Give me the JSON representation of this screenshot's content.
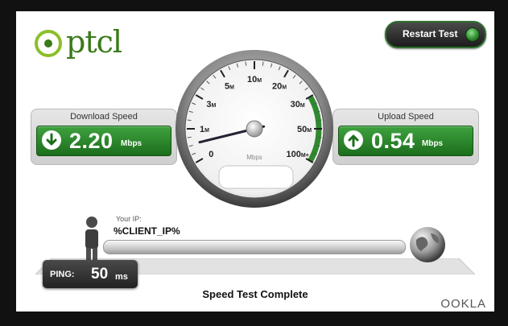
{
  "brand": {
    "logo_text": "ptcl",
    "footer_logo": "OOKLA",
    "accent": "#2f8a2f"
  },
  "header": {
    "restart_label": "Restart Test"
  },
  "download": {
    "title": "Download Speed",
    "value": "2.20",
    "unit": "Mbps",
    "icon": "down-arrow-icon"
  },
  "upload": {
    "title": "Upload Speed",
    "value": "0.54",
    "unit": "Mbps",
    "icon": "up-arrow-icon"
  },
  "gauge": {
    "unit_label": "Mbps",
    "ticks": [
      {
        "label": "0",
        "sub": ""
      },
      {
        "label": "1",
        "sub": "M"
      },
      {
        "label": "3",
        "sub": "M"
      },
      {
        "label": "5",
        "sub": "M"
      },
      {
        "label": "10",
        "sub": "M"
      },
      {
        "label": "20",
        "sub": "M"
      },
      {
        "label": "30",
        "sub": "M"
      },
      {
        "label": "50",
        "sub": "M"
      },
      {
        "label": "100",
        "sub": "M+"
      }
    ],
    "needle_value_mbps": 0.54
  },
  "connection": {
    "ip_label": "Your IP:",
    "ip_value": "%CLIENT_IP%",
    "ping_label": "PING:",
    "ping_value": "50",
    "ping_unit": "ms"
  },
  "status": {
    "text": "Speed Test Complete"
  }
}
